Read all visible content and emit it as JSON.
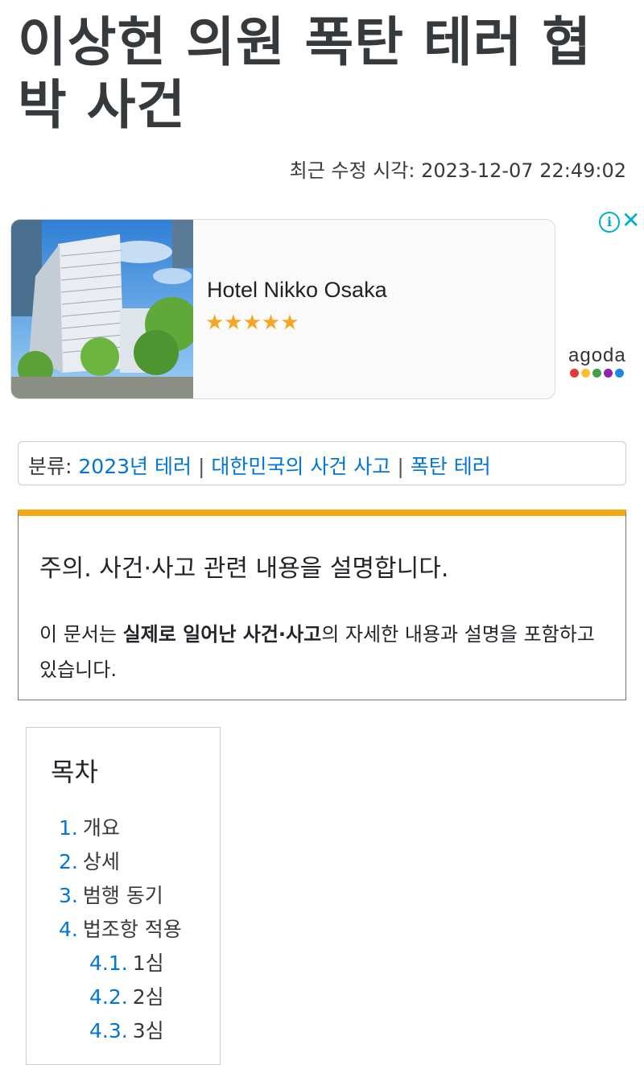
{
  "page": {
    "title": "이상헌 의원 폭탄 테러 협박 사건",
    "last_modified": "최근 수정 시각: 2023-12-07 22:49:02"
  },
  "ad": {
    "hotel_name": "Hotel Nikko Osaka",
    "stars": "★★★★★",
    "info_icon": "info-icon",
    "close_icon": "close-icon",
    "brand": "agoda",
    "brand_dot_colors": [
      "#e53935",
      "#fbc02d",
      "#43a047",
      "#8e24aa",
      "#1e88e5"
    ]
  },
  "categories": {
    "label": "분류:",
    "items": [
      "2023년 테러",
      "대한민국의 사건 사고",
      "폭탄 테러"
    ],
    "separator": "|"
  },
  "notice": {
    "heading": "주의. 사건·사고 관련 내용을 설명합니다.",
    "text_pre": "이 문서는 ",
    "text_bold": "실제로 일어난 사건·사고",
    "text_post": "의 자세한 내용과 설명을 포함하고 있습니다.",
    "accent_color": "#f3a712"
  },
  "toc": {
    "heading": "목차",
    "items": [
      {
        "num": "1.",
        "label": "개요",
        "level": 1
      },
      {
        "num": "2.",
        "label": "상세",
        "level": 1
      },
      {
        "num": "3.",
        "label": "범행 동기",
        "level": 1
      },
      {
        "num": "4.",
        "label": "법조항 적용",
        "level": 1
      },
      {
        "num": "4.1.",
        "label": "1심",
        "level": 2
      },
      {
        "num": "4.2.",
        "label": "2심",
        "level": 2
      },
      {
        "num": "4.3.",
        "label": "3심",
        "level": 2
      }
    ]
  }
}
